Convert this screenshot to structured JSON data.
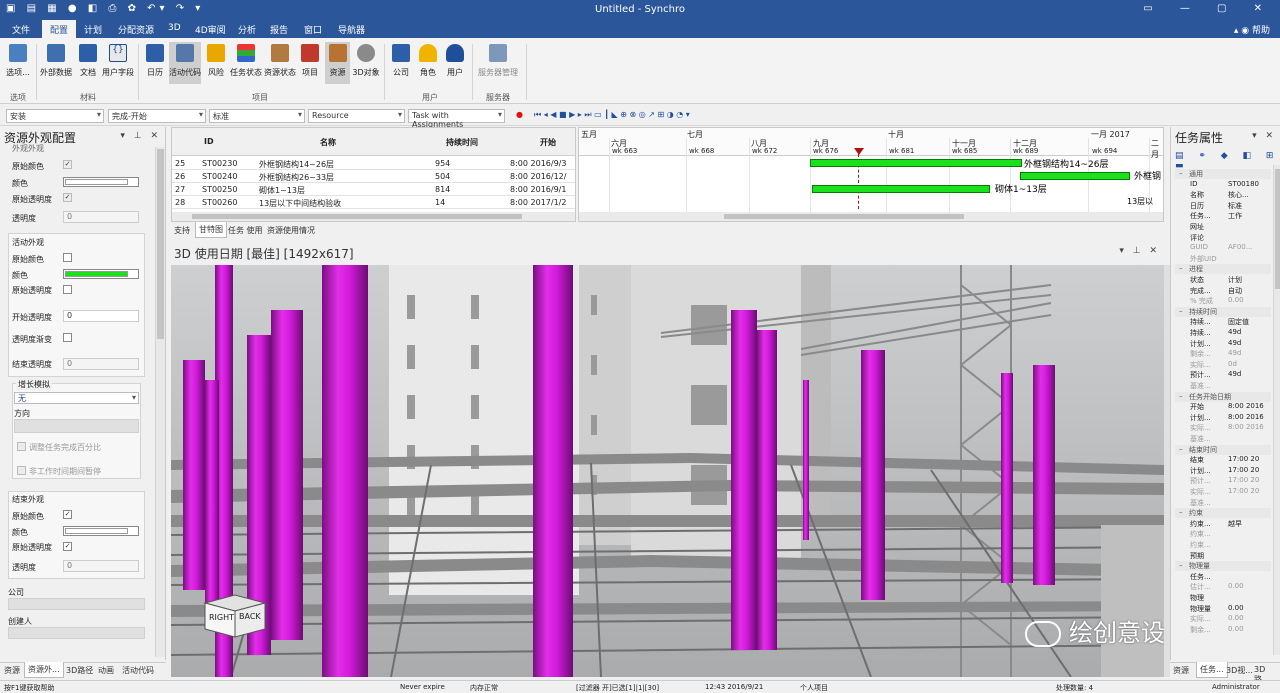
{
  "window": {
    "title": "Untitled - Synchro"
  },
  "menu": {
    "items": [
      "文件",
      "配置",
      "计划",
      "分配资源",
      "3D",
      "4D审阅",
      "分析",
      "报告",
      "窗口",
      "导航器"
    ],
    "active": "配置",
    "help": "帮助"
  },
  "ribbon": {
    "buttons": [
      "选项...",
      "外部数据",
      "文档",
      "用户字段",
      "日历",
      "活动代码",
      "风险",
      "任务状态",
      "资源状态",
      "项目",
      "资源",
      "3D对象",
      "公司",
      "角色",
      "用户",
      "服务器管理"
    ],
    "groups": [
      "选项",
      "材料",
      "项目",
      "用户",
      "服务器"
    ]
  },
  "toolbar": {
    "combo1": "安装",
    "combo2": "完成-开始",
    "combo3": "标准",
    "combo4": "Resource",
    "combo5": "Task with Assignments"
  },
  "left_pane": {
    "title": "资源外观配置",
    "top_label": "外观外观",
    "s1_orig_color": "原始颜色",
    "s1_color": "颜色",
    "s1_orig_trans": "原始透明度",
    "s1_trans": "透明度",
    "s1_trans_val": "0",
    "active_group": "活动外观",
    "a_orig_color": "原始颜色",
    "a_color": "颜色",
    "a_orig_trans": "原始透明度",
    "a_start_trans": "开始透明度",
    "a_start_val": "0",
    "a_trans_vary": "透明度渐变",
    "a_end_trans": "结束透明度",
    "a_end_val": "0",
    "grow_group": "增长模拟",
    "grow_val": "无",
    "direction": "方向",
    "scale_opt": "调整任务完成百分比",
    "pause_opt": "非工作时间期间暂停",
    "end_group": "结束外观",
    "e_orig_color": "原始颜色",
    "e_color": "颜色",
    "e_orig_trans": "原始透明度",
    "e_trans": "透明度",
    "e_trans_val": "0",
    "company": "公司",
    "creator": "创建人",
    "tabs": [
      "资源",
      "资源外...",
      "3D路径",
      "动画",
      "活动代码"
    ]
  },
  "grid": {
    "headers": [
      "ID",
      "名称",
      "持续时间",
      "开始"
    ],
    "rows": [
      {
        "num": "25",
        "id": "ST00230",
        "name": "外框钢结构14~26层",
        "dur": "954",
        "start": "8:00 2016/9/3"
      },
      {
        "num": "26",
        "id": "ST00240",
        "name": "外框钢结构26~33层",
        "dur": "504",
        "start": "8:00 2016/12/"
      },
      {
        "num": "27",
        "id": "ST00250",
        "name": "砌体1~13层",
        "dur": "814",
        "start": "8:00 2016/9/1"
      },
      {
        "num": "28",
        "id": "ST00260",
        "name": "13层以下中间结构验收",
        "dur": "14",
        "start": "8:00 2017/1/2"
      }
    ]
  },
  "gantt": {
    "months": [
      "五月",
      "六月",
      "七月",
      "八月",
      "九月",
      "十月",
      "十一月",
      "十二月",
      "一月 2017",
      "二月"
    ],
    "weeks": [
      "wk 663",
      "wk 668",
      "wk 672",
      "wk 676",
      "wk 681",
      "wk 685",
      "wk 689",
      "wk 694"
    ],
    "labels": [
      "外框钢结构14~26层",
      "外框钢",
      "砌体1~13层",
      "13层以"
    ]
  },
  "view_tabs": [
    "支持",
    "甘特图",
    "任务 使用",
    "资源使用情况"
  ],
  "viewport": {
    "title": "3D 使用日期 [最佳] [1492x617]",
    "cube_right": "RIGHT",
    "cube_back": "BACK"
  },
  "right_pane": {
    "title": "任务属性",
    "rows": [
      {
        "t": "sec",
        "k": "通用"
      },
      {
        "k": "ID",
        "v": "ST00180"
      },
      {
        "k": "名称",
        "v": "核心..."
      },
      {
        "k": "日历",
        "v": "标准"
      },
      {
        "k": "任务...",
        "v": "工作"
      },
      {
        "k": "网址",
        "v": ""
      },
      {
        "k": "评论",
        "v": ""
      },
      {
        "k": "GUID",
        "v": "AF00...",
        "g": 1
      },
      {
        "k": "外部UID",
        "v": "",
        "g": 1
      },
      {
        "t": "sec",
        "k": "进程"
      },
      {
        "k": "状态",
        "v": "计划"
      },
      {
        "k": "完成...",
        "v": "自动"
      },
      {
        "k": "% 完成",
        "v": "0.00",
        "g": 1
      },
      {
        "t": "sec",
        "k": "持续时间"
      },
      {
        "k": "持续...",
        "v": "固定值"
      },
      {
        "k": "持续...",
        "v": "49d"
      },
      {
        "k": "计划...",
        "v": "49d"
      },
      {
        "k": "剩余...",
        "v": "49d",
        "g": 1
      },
      {
        "k": "实际...",
        "v": "0d",
        "g": 1
      },
      {
        "k": "预计...",
        "v": "49d"
      },
      {
        "k": "基准...",
        "v": "",
        "g": 1
      },
      {
        "t": "sec",
        "k": "任务开始日期"
      },
      {
        "k": "开始",
        "v": "8:00 2016"
      },
      {
        "k": "计划...",
        "v": "8:00 2016"
      },
      {
        "k": "实际...",
        "v": "8:00 2016",
        "g": 1
      },
      {
        "k": "基准...",
        "v": "",
        "g": 1
      },
      {
        "t": "sec",
        "k": "结束时间"
      },
      {
        "k": "结束",
        "v": "17:00 20"
      },
      {
        "k": "计划...",
        "v": "17:00 20"
      },
      {
        "k": "预计...",
        "v": "17:00 20",
        "g": 1
      },
      {
        "k": "实际...",
        "v": "17:00 20",
        "g": 1
      },
      {
        "k": "基准...",
        "v": "",
        "g": 1
      },
      {
        "t": "sec",
        "k": "约束"
      },
      {
        "k": "约束...",
        "v": "越早"
      },
      {
        "k": "约束...",
        "v": "",
        "g": 1
      },
      {
        "k": "约束...",
        "v": "",
        "g": 1
      },
      {
        "k": "预期",
        "v": ""
      },
      {
        "t": "sec",
        "k": "物理量"
      },
      {
        "k": "任务...",
        "v": ""
      },
      {
        "k": "估计...",
        "v": "0.00",
        "g": 1
      },
      {
        "k": "物理",
        "v": ""
      },
      {
        "k": "物理量",
        "v": "0.00"
      },
      {
        "k": "实际...",
        "v": "0.00",
        "g": 1
      },
      {
        "k": "剩余...",
        "v": "0.00",
        "g": 1
      }
    ],
    "tabs": [
      "资源",
      "任务...",
      "3D视...",
      "3D路..."
    ]
  },
  "status": {
    "help": "按F1键获取帮助",
    "never": "Never expire",
    "mem": "内存正常",
    "filter": "[过滤器 开]已选[1]|1|[30]",
    "time": "12:43 2016/9/21",
    "project": "个人项目",
    "count": "处理数量: 4",
    "user": "Administrator"
  },
  "watermark": "绘创意设计",
  "colors": {
    "title_blue": "#2b579a",
    "purple": "#cc18d4",
    "green": "#19e21a"
  }
}
